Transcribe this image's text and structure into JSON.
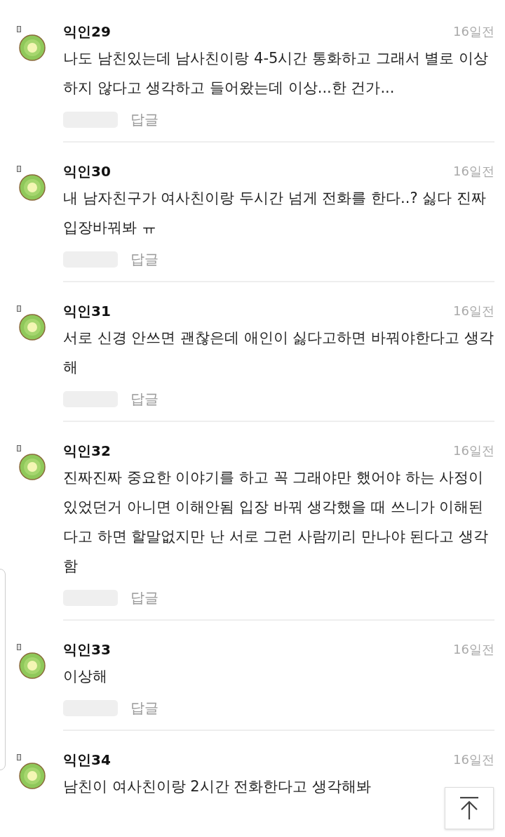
{
  "comments": [
    {
      "author": "익인29",
      "time": "16일전",
      "text": "나도 남친있는데 남사친이랑 4-5시간 통화하고 그래서 별로 이상하지 않다고 생각하고 들어왔는데 이상...한 건가...",
      "reply": "답글"
    },
    {
      "author": "익인30",
      "time": "16일전",
      "text": "내 남자친구가 여사친이랑 두시간 넘게 전화를 한다..? 싫다 진짜 입장바꿔봐 ㅠ",
      "reply": "답글"
    },
    {
      "author": "익인31",
      "time": "16일전",
      "text": "서로 신경 안쓰면 괜찮은데 애인이 싫다고하면 바꿔야한다고 생각해",
      "reply": "답글"
    },
    {
      "author": "익인32",
      "time": "16일전",
      "text": "진짜진짜 중요한 이야기를 하고 꼭 그래야만 했어야 하는 사정이 있었던거 아니면 이해안됨 입장 바꿔 생각했을 때 쓰니가 이해된다고 하면 할말없지만 난 서로 그런 사람끼리 만나야 된다고 생각함",
      "reply": "답글"
    },
    {
      "author": "익인33",
      "time": "16일전",
      "text": "이상해",
      "reply": "답글"
    },
    {
      "author": "익인34",
      "time": "16일전",
      "text": "남친이 여사친이랑 2시간 전화한다고 생각해봐"
    }
  ]
}
